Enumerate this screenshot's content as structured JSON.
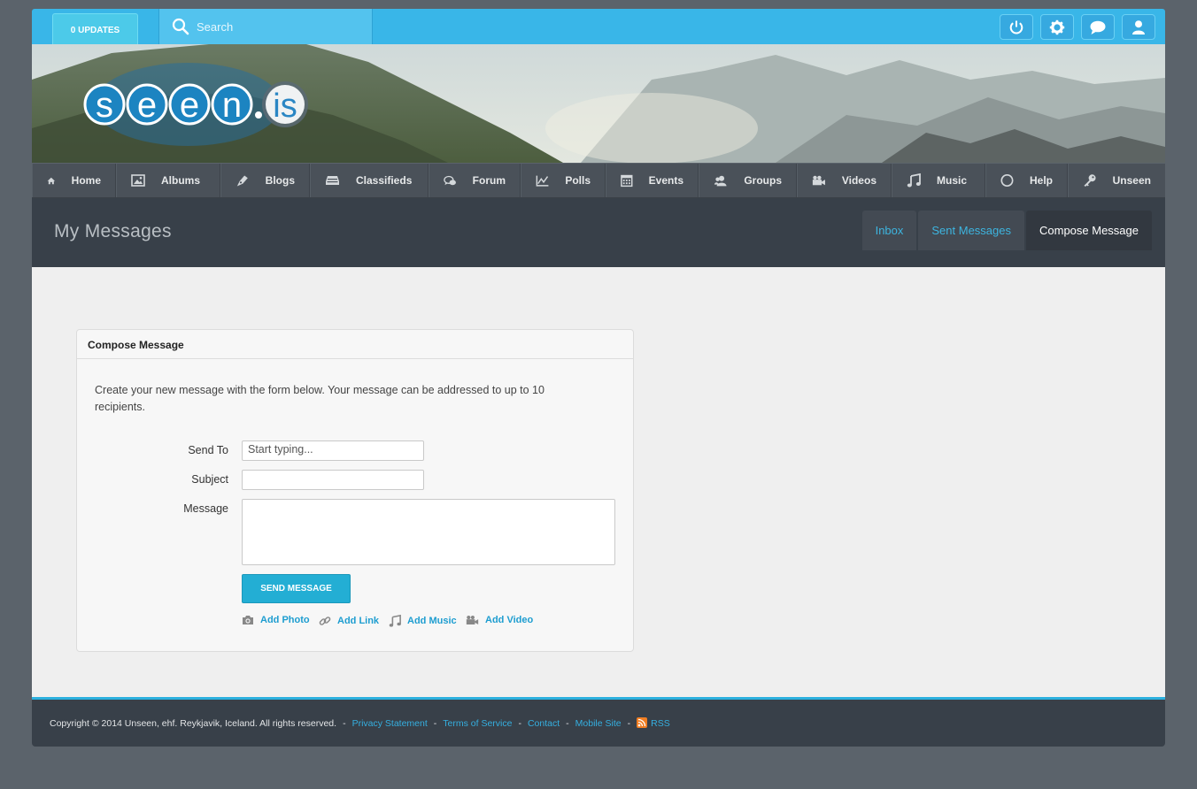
{
  "topbar": {
    "updates_label": "0 UPDATES",
    "search_placeholder": "Search",
    "icons": [
      "power-icon",
      "gear-icon",
      "chat-icon",
      "user-icon"
    ]
  },
  "banner": {
    "logo_text": "seen.is"
  },
  "nav": {
    "items": [
      {
        "label": "Home",
        "icon": "home-icon"
      },
      {
        "label": "Albums",
        "icon": "image-icon"
      },
      {
        "label": "Blogs",
        "icon": "pen-icon"
      },
      {
        "label": "Classifieds",
        "icon": "tray-icon"
      },
      {
        "label": "Forum",
        "icon": "forum-icon"
      },
      {
        "label": "Polls",
        "icon": "chart-icon"
      },
      {
        "label": "Events",
        "icon": "calendar-icon"
      },
      {
        "label": "Groups",
        "icon": "group-icon"
      },
      {
        "label": "Videos",
        "icon": "video-icon"
      },
      {
        "label": "Music",
        "icon": "music-icon"
      },
      {
        "label": "Help",
        "icon": "circle-icon"
      },
      {
        "label": "Unseen",
        "icon": "key-icon"
      }
    ]
  },
  "header": {
    "title": "My Messages",
    "tabs": [
      {
        "label": "Inbox"
      },
      {
        "label": "Sent Messages"
      },
      {
        "label": "Compose Message",
        "active": true
      }
    ]
  },
  "compose": {
    "card_title": "Compose Message",
    "intro": "Create your new message with the form below. Your message can be addressed to up to 10 recipients.",
    "send_to_label": "Send To",
    "send_to_placeholder": "Start typing...",
    "subject_label": "Subject",
    "subject_value": "",
    "message_label": "Message",
    "message_value": "",
    "send_button": "SEND MESSAGE",
    "attachments": [
      {
        "label": "Add Photo",
        "icon": "camera-icon"
      },
      {
        "label": "Add Link",
        "icon": "link-icon"
      },
      {
        "label": "Add Music",
        "icon": "music-icon"
      },
      {
        "label": "Add Video",
        "icon": "video-icon"
      }
    ]
  },
  "footer": {
    "copyright": "Copyright © 2014 Unseen, ehf. Reykjavik, Iceland. All rights reserved.",
    "links": [
      "Privacy Statement",
      "Terms of Service",
      "Contact",
      "Mobile Site",
      "RSS"
    ],
    "separator": "-"
  },
  "colors": {
    "accent": "#39b6e8",
    "dark_header": "#384049",
    "nav_bg": "#4a5159",
    "link": "#1d9dd0",
    "rss": "#f07e23"
  }
}
